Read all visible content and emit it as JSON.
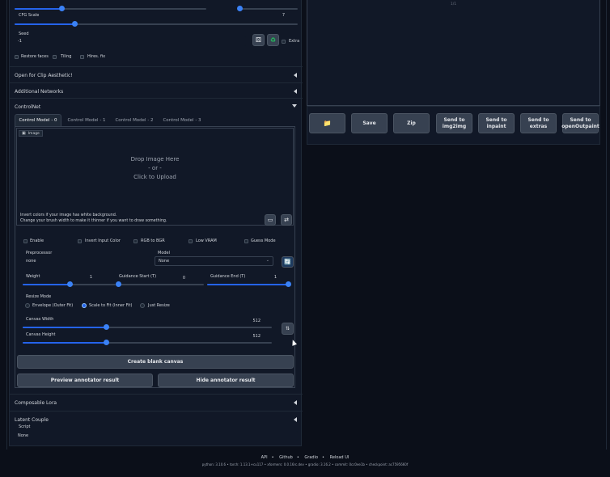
{
  "top": {
    "cfg_label": "CFG Scale",
    "cfg_value": "7",
    "seed_label": "Seed",
    "seed_value": "-1",
    "extra_label": "Extra",
    "restore_faces": "Restore faces",
    "tiling": "Tiling",
    "hires_fix": "Hires. fix"
  },
  "accordions": {
    "clip_aesthetic": "Open for Clip Aesthetic!",
    "additional_networks": "Additional Networks",
    "controlnet": "ControlNet",
    "composable_lora": "Composable Lora",
    "latent_couple": "Latent Couple"
  },
  "controlnet": {
    "tabs": [
      "Control Model - 0",
      "Control Model - 1",
      "Control Model - 2",
      "Control Model - 3"
    ],
    "image_label": "Image",
    "drop_line1": "Drop Image Here",
    "drop_line2": "- or -",
    "drop_line3": "Click to Upload",
    "hint1": "Invert colors if your image has white background.",
    "hint2": "Change your brush width to make it thinner if you want to draw something.",
    "checks": [
      "Enable",
      "Invert Input Color",
      "RGB to BGR",
      "Low VRAM",
      "Guess Mode"
    ],
    "preprocessor_label": "Preprocessor",
    "preprocessor_value": "none",
    "model_label": "Model",
    "model_value": "None",
    "weight_label": "Weight",
    "weight_value": "1",
    "gstart_label": "Guidance Start (T)",
    "gstart_value": "0",
    "gend_label": "Guidance End (T)",
    "gend_value": "1",
    "resize_label": "Resize Mode",
    "resize_options": [
      "Envelope (Outer Fit)",
      "Scale to Fit (Inner Fit)",
      "Just Resize"
    ],
    "canvas_width_label": "Canvas Width",
    "canvas_width_value": "512",
    "canvas_height_label": "Canvas Height",
    "canvas_height_value": "512",
    "create_canvas": "Create blank canvas",
    "preview_annotator": "Preview annotator result",
    "hide_annotator": "Hide annotator result"
  },
  "script": {
    "label": "Script",
    "value": "None"
  },
  "output": {
    "counter": "1/1",
    "buttons": [
      "Save",
      "Zip",
      "Send to img2img",
      "Send to inpaint",
      "Send to extras",
      "Send to openOutpaint"
    ]
  },
  "footer": {
    "links": [
      "API",
      "Github",
      "Gradio",
      "Reload UI"
    ],
    "versions": "python: 3.10.6  •  torch: 1.13.1+cu117  •  xformers: 0.0.16rc.dev  •  gradio: 3.16.2  •  commit: 0cc0ee1b  •  checkpoint: ac7595660f"
  },
  "colors": {
    "accent": "#2563eb",
    "panel": "#111827",
    "background": "#0b0f19"
  }
}
